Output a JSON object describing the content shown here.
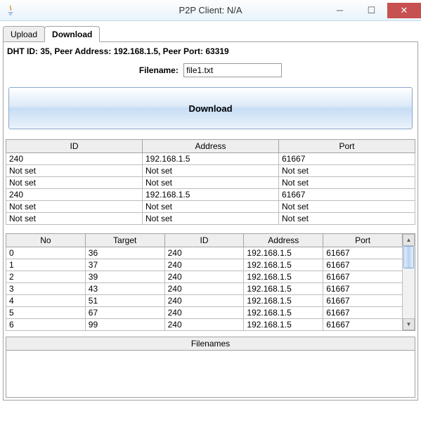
{
  "window": {
    "title": "P2P Client: N/A"
  },
  "tabs": {
    "upload": "Upload",
    "download": "Download"
  },
  "status": "DHT ID: 35, Peer Address: 192.168.1.5, Peer Port: 63319",
  "filename": {
    "label": "Filename:",
    "value": "file1.txt"
  },
  "download_btn": "Download",
  "table1": {
    "headers": {
      "id": "ID",
      "address": "Address",
      "port": "Port"
    },
    "rows": [
      {
        "id": "240",
        "address": "192.168.1.5",
        "port": "61667"
      },
      {
        "id": "Not set",
        "address": "Not set",
        "port": "Not set"
      },
      {
        "id": "Not set",
        "address": "Not set",
        "port": "Not set"
      },
      {
        "id": "240",
        "address": "192.168.1.5",
        "port": "61667"
      },
      {
        "id": "Not set",
        "address": "Not set",
        "port": "Not set"
      },
      {
        "id": "Not set",
        "address": "Not set",
        "port": "Not set"
      }
    ]
  },
  "table2": {
    "headers": {
      "no": "No",
      "target": "Target",
      "id": "ID",
      "address": "Address",
      "port": "Port"
    },
    "rows": [
      {
        "no": "0",
        "target": "36",
        "id": "240",
        "address": "192.168.1.5",
        "port": "61667"
      },
      {
        "no": "1",
        "target": "37",
        "id": "240",
        "address": "192.168.1.5",
        "port": "61667"
      },
      {
        "no": "2",
        "target": "39",
        "id": "240",
        "address": "192.168.1.5",
        "port": "61667"
      },
      {
        "no": "3",
        "target": "43",
        "id": "240",
        "address": "192.168.1.5",
        "port": "61667"
      },
      {
        "no": "4",
        "target": "51",
        "id": "240",
        "address": "192.168.1.5",
        "port": "61667"
      },
      {
        "no": "5",
        "target": "67",
        "id": "240",
        "address": "192.168.1.5",
        "port": "61667"
      },
      {
        "no": "6",
        "target": "99",
        "id": "240",
        "address": "192.168.1.5",
        "port": "61667"
      }
    ]
  },
  "filenames": {
    "header": "Filenames"
  }
}
